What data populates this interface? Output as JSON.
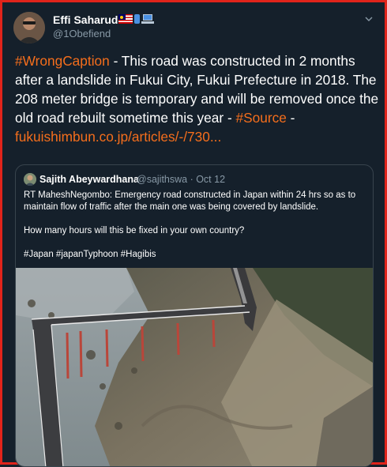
{
  "tweet": {
    "author_name": "Effi Saharudin",
    "author_handle": "@1Obefiend",
    "flag_icons": [
      "malaysia-flag-icon",
      "mobile-phone-icon",
      "laptop-icon"
    ],
    "menu_icon": "chevron-down-icon",
    "text_parts": {
      "tag_wrongcaption": "#WrongCaption",
      "body": " - This road was constructed in 2 months after a landslide in Fukui City, Fukui Prefecture in 2018. The 208 meter bridge is temporary and will be removed once the old road rebuilt sometime this year - ",
      "tag_source": "#Source",
      "sep": " - ",
      "link": "fukuishimbun.co.jp/articles/-/730..."
    }
  },
  "quoted_tweet": {
    "author_name": "Sajith Abeywardhana",
    "handle_date": "@sajithswa · Oct 12",
    "line1": "RT MaheshNegombo: Emergency road constructed in Japan within 24 hrs so as to maintain flow of traffic after the main one was being covered by landslide.",
    "line2": "How many hours will this be fixed in your own country?",
    "line3": "#Japan #japanTyphoon #Hagibis"
  },
  "colors": {
    "background": "#15202b",
    "text": "#ffffff",
    "muted": "#8899a6",
    "highlight": "#f56e1c",
    "frame_border": "#e0241b"
  }
}
